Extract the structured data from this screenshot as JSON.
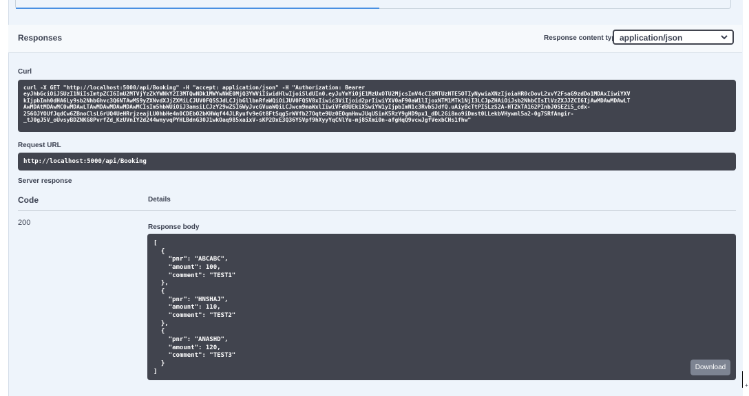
{
  "responses": {
    "title": "Responses",
    "content_type_label": "Response content type",
    "content_type_value": "application/json"
  },
  "curl": {
    "label": "Curl",
    "command": "curl -X GET \"http://localhost:5000/api/Booking\" -H \"accept: application/json\" -H \"Authorization: Bearer\neyJhbGciOiJSUzI1NiIsImtpZCI6ImU2MTVjYzZkYWNkY2I3MTQwNDk1MWYwNWE0MjQ3YWViIiwidHlwIjoiSldUIn0.eyJuYmYiOjE1MzUxOTU2MjcsImV4cCI6MTUzNTE5OTIyNywiaXNzIjoiaHR0cDovL2xvY2FsaG9zdDo1MDAxIiwiYXV\nkIjpbImh0dHA6Ly9sb2NhbGhvc3Q6NTAwMS9yZXNvdXJjZXMiLCJUV0FQSSJdLCJjbGllbnRfaWQiOiJUV0FQSV8xIiwic3ViIjoid2prIiwiYXV0aF90aW1lIjoxNTM1MTk1NjI3LCJpZHAiOiJsb2NhbCIsIlVzZXJJZCI6IjAwMDAwMDAwLT\nAwMDAtMDAwMC0wMDAwLTAwMDAwMDAwMDAwMCIsIm5hbWUiOiJ3amsiLCJzY29wZSI6WyJvcGVuaWQiLCJwcm9maWxlIiwiVFdBUEkiXSwiYW1yIjpbImN1c3RvbSJdfQ.uAiyBcTtPISLzS2A-HTZkTA162PInbJOSEZi5_cdx-\n256OJYOUfJqdCw6ZBnoClsL6rUQ4UeHRrjzeajLU0hbHe4n0CDEbO2bKHWqf44JLRyufv9eGt8FtSqg5rWVfb27Oqte9Uz0EOqmHnwJUqUSinK5RzY9gHD9px1_dDL2Gi8no9iDmst0LLekbVHywml5a2-0g7SRfAngir-\n_tJ0gJ5V_oUvsyBDZNKG8PvrfZd_KzUVnIY2d244wnyvqPYHLBdnG30J1wkOaq985xaixV-sKP2DxE3Q36YSVpf9hXyyYqCNlYu-mj85Xmi0n-afgHqQ9vcwJgfVexbCHs1fhw\""
  },
  "request_url": {
    "label": "Request URL",
    "value": "http://localhost:5000/api/Booking"
  },
  "server_response": {
    "label": "Server response",
    "col_code": "Code",
    "col_details": "Details",
    "code": "200",
    "body_label": "Response body",
    "body": "[\n  {\n    \"pnr\": \"ABCABC\",\n    \"amount\": 100,\n    \"comment\": \"TEST1\"\n  },\n  {\n    \"pnr\": \"HNSHAJ\",\n    \"amount\": 110,\n    \"comment\": \"TEST2\"\n  },\n  {\n    \"pnr\": \"ANASHD\",\n    \"amount\": 120,\n    \"comment\": \"TEST3\"\n  }\n]",
    "download_label": "Download"
  },
  "icons": {
    "select": "chevron-down-icon"
  },
  "colors": {
    "code_background": "#41444e",
    "panel_background": "#eef4fb",
    "download_button": "#7d8492",
    "accent": "#4990e2"
  }
}
